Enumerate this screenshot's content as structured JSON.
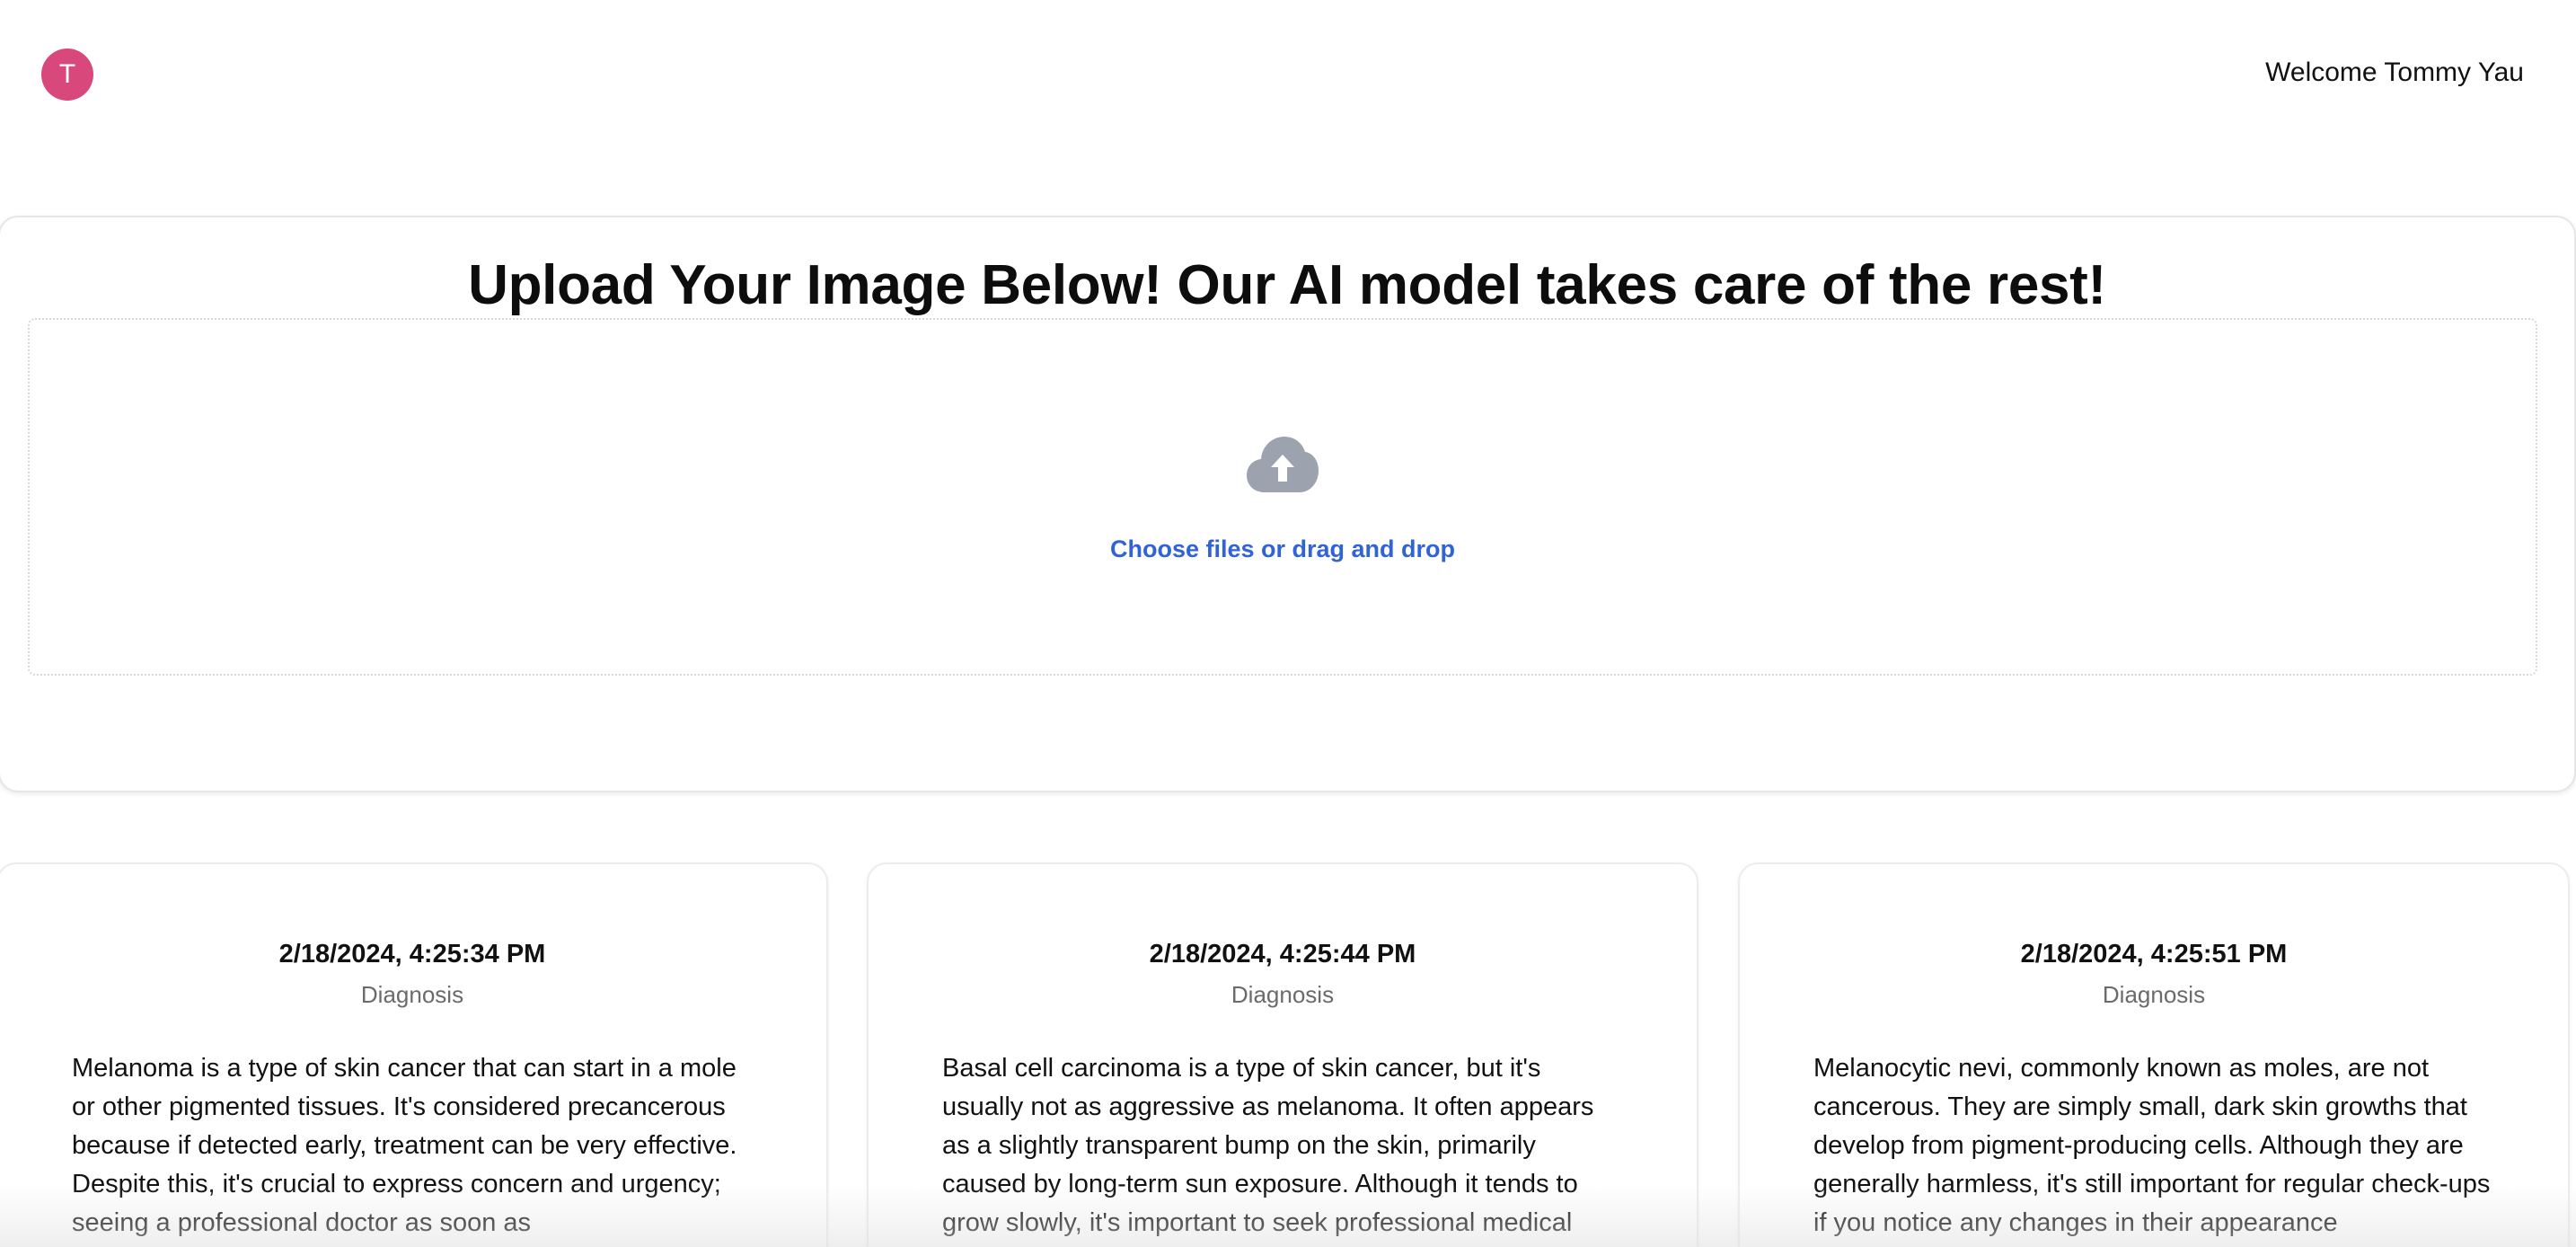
{
  "header": {
    "avatar_initial": "T",
    "welcome_text": "Welcome Tommy Yau"
  },
  "upload": {
    "title": "Upload Your Image Below! Our AI model takes care of the rest!",
    "icon": "cloud-upload-icon",
    "choose_label": "Choose files or drag and drop"
  },
  "results": [
    {
      "date": "2/18/2024, 4:25:34 PM",
      "label": "Diagnosis",
      "description": "Melanoma is a type of skin cancer that can start in a mole or other pigmented tissues. It's considered precancerous because if detected early, treatment can be very effective. Despite this, it's crucial to express concern and urgency; seeing a professional doctor as soon as"
    },
    {
      "date": "2/18/2024, 4:25:44 PM",
      "label": "Diagnosis",
      "description": "Basal cell carcinoma is a type of skin cancer, but it's usually not as aggressive as melanoma. It often appears as a slightly transparent bump on the skin, primarily caused by long-term sun exposure. Although it tends to grow slowly, it's important to seek professional medical"
    },
    {
      "date": "2/18/2024, 4:25:51 PM",
      "label": "Diagnosis",
      "description": "Melanocytic nevi, commonly known as moles, are not cancerous. They are simply small, dark skin growths that develop from pigment-producing cells. Although they are generally harmless, it's still important for regular check-ups if you notice any changes in their appearance"
    }
  ],
  "colors": {
    "avatar": "#d9487a",
    "link": "#2f63d6",
    "icon": "#9ca3af"
  }
}
